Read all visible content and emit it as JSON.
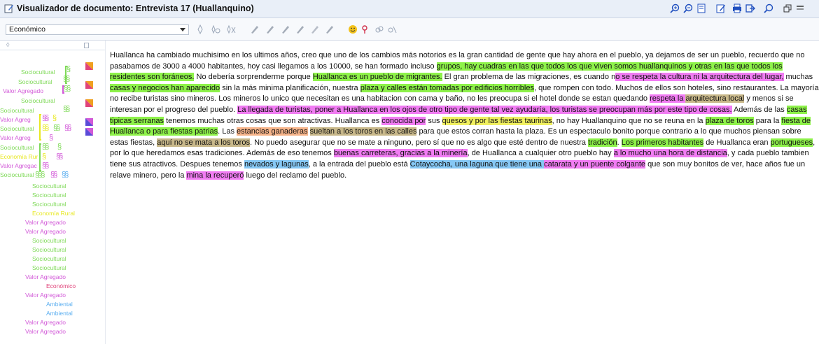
{
  "window": {
    "title": "Visualizador de documento: Entrevista 17 (Huallanquino)",
    "title_icon": "edit-document-icon",
    "right_icons": [
      "zoom-in-icon",
      "zoom-out-icon",
      "fit-page-icon",
      "edit-icon",
      "print-icon",
      "export-icon",
      "search-icon",
      "pin-icon"
    ]
  },
  "toolbar": {
    "code_select_value": "Económico",
    "icons": [
      "add-code-icon",
      "code-in-vivo-icon",
      "remove-code-icon",
      "highlighter-icon",
      "highlighter-icon",
      "highlighter-icon",
      "highlighter-icon",
      "highlighter-icon",
      "highlighter-icon",
      "emoticon-icon",
      "pin-icon",
      "link-icon",
      "unlink-icon"
    ]
  },
  "filter_row": {
    "filter_symbol": "◊"
  },
  "margin_codes": [
    "Sociocultural",
    "Sociocultural",
    "Valor Agregado",
    "Sociocultural",
    "Sociocultural",
    "Valor Agreg",
    "Sociocultural",
    "Valor Agreg",
    "Sociocultural",
    "Economía Rur",
    "Valor Agregac",
    "Sociocultural",
    "Sociocultural",
    "Sociocultural",
    "Sociocultural",
    "Economía Rural",
    "Valor Agregado",
    "Valor Agregado",
    "Sociocultural",
    "Sociocultural",
    "Sociocultural",
    "Sociocultural",
    "Valor Agregado",
    "Económico",
    "Valor Agregado",
    "Ambiental",
    "Ambiental",
    "Valor Agregado",
    "Valor Agregado"
  ],
  "colors": {
    "sociocultural": "#7ed957",
    "valor_agregado": "#d25ad8",
    "economia_rural": "#e8e820",
    "economico": "#e0447a",
    "ambiental": "#5aaef0",
    "highlight_green": "#8ef24a",
    "highlight_pink": "#f17cf3",
    "highlight_tan": "#c8b88a",
    "highlight_blue": "#86c8f5",
    "highlight_orange": "#f6b48a",
    "highlight_yellow": "#f0f060"
  },
  "document": {
    "segments": [
      {
        "t": "Huallanca ha cambiado muchisimo en los ultimos años, creo que uno de los cambios más notorios es la gran cantidad de gente que hay ahora en el pueblo, ya dejamos de ser un pueblo, recuerdo que no pasabamos de 3000 a 4000 habitantes, hoy casi llegamos a los 10000, se han formado incluso ",
        "c": ""
      },
      {
        "t": "grupos, hay cuadras en las que todos los que viven somos huallanquinos y otras en las que todos los residentes son foráneos.",
        "c": "g"
      },
      {
        "t": " No debería sorprenderme porque ",
        "c": ""
      },
      {
        "t": "Huallanca es un pueblo de migrantes.",
        "c": "g"
      },
      {
        "t": " El gran problema de las migraciones, es cuando n",
        "c": ""
      },
      {
        "t": "o se respeta la cultura ni la arquitectura del lugar,",
        "c": "p"
      },
      {
        "t": " muchas ",
        "c": ""
      },
      {
        "t": "casas y negocios han aparecido",
        "c": "g"
      },
      {
        "t": " sin la más minima planificación, nuestra ",
        "c": ""
      },
      {
        "t": "plaza y calles están tomadas por edificios horribles",
        "c": "g"
      },
      {
        "t": ", que rompen con todo. Muchos de ellos son hoteles, sino restaurantes. La mayoría no recibe turistas sino mineros. Los mineros lo unico que necesitan es una habitacion con cama y baño, no les preocupa si el hotel donde se estan quedando ",
        "c": ""
      },
      {
        "t": "respeta la ",
        "c": "p"
      },
      {
        "t": "arquitectura local",
        "c": "t"
      },
      {
        "t": " y menos si se interesan por el progreso del pueblo. ",
        "c": ""
      },
      {
        "t": "La llegada de turistas, poner a Huallanca en los ojos de otro tipo de gente tal vez ayudaría, los turistas se preocupan más por este tipo de cosas.",
        "c": "p"
      },
      {
        "t": " Además de las ",
        "c": ""
      },
      {
        "t": "casas tipicas serranas",
        "c": "g"
      },
      {
        "t": " tenemos muchas otras cosas que son atractivas. Huallanca es ",
        "c": ""
      },
      {
        "t": "conocida por",
        "c": "p"
      },
      {
        "t": " sus ",
        "c": ""
      },
      {
        "t": "quesos y por las fiestas taurinas",
        "c": "y"
      },
      {
        "t": ", no hay Huallanquino que no se reuna en la ",
        "c": ""
      },
      {
        "t": "plaza de toros",
        "c": "g"
      },
      {
        "t": " para la ",
        "c": ""
      },
      {
        "t": "fiesta de Huallanca o para fiestas patrias",
        "c": "g"
      },
      {
        "t": ". Las ",
        "c": ""
      },
      {
        "t": "estancias ganaderas",
        "c": "o"
      },
      {
        "t": " ",
        "c": ""
      },
      {
        "t": "sueltan a los toros en las calles",
        "c": "t"
      },
      {
        "t": " para que estos corran hasta la plaza. Es un espectaculo bonito porque contrario a lo que muchos piensan sobre estas fiestas, ",
        "c": ""
      },
      {
        "t": "aquí no se mata a los toros",
        "c": "t"
      },
      {
        "t": ". No puedo asegurar que no se mate a ninguno, pero sí que no es algo que esté dentro de nuestra ",
        "c": ""
      },
      {
        "t": "tradición",
        "c": "g"
      },
      {
        "t": ". ",
        "c": ""
      },
      {
        "t": "Los primeros habitantes",
        "c": "g"
      },
      {
        "t": " de Huallanca eran ",
        "c": ""
      },
      {
        "t": "portugueses",
        "c": "g"
      },
      {
        "t": ", por lo que heredamos esas tradiciones. Además de eso tenemos ",
        "c": ""
      },
      {
        "t": "buenas carreteras, gracias a la minería",
        "c": "p"
      },
      {
        "t": ", de Huallanca a cualquier otro pueblo hay ",
        "c": ""
      },
      {
        "t": "a lo mucho una hora de distancia",
        "c": "p"
      },
      {
        "t": ", y cada pueblo tambien tiene sus atractivos. Despues tenemos ",
        "c": ""
      },
      {
        "t": "nevados y lagunas",
        "c": "b"
      },
      {
        "t": ", a la entrada del pueblo está ",
        "c": ""
      },
      {
        "t": "Cotaycocha, una laguna que tiene una ",
        "c": "b"
      },
      {
        "t": "catarata y un puente colgante",
        "c": "p"
      },
      {
        "t": " que son muy bonitos de ver, hace años fue un relave minero, pero la ",
        "c": ""
      },
      {
        "t": "mina la recuperó",
        "c": "p"
      },
      {
        "t": " luego del reclamo del pueblo.",
        "c": ""
      }
    ]
  }
}
